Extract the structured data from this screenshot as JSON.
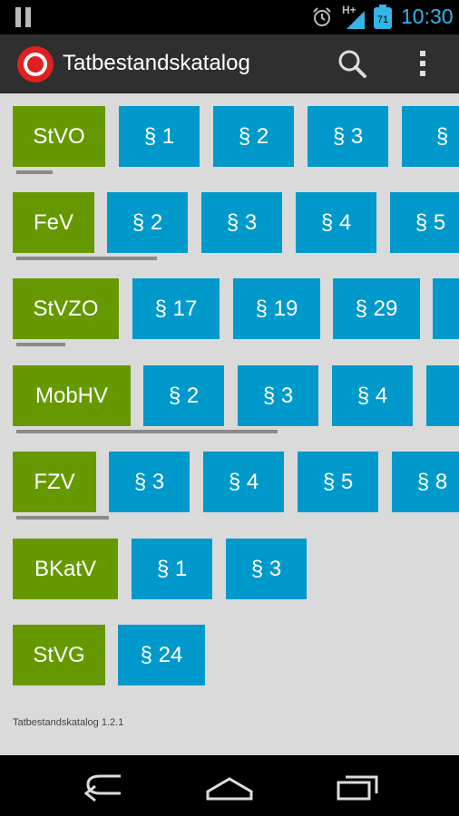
{
  "status": {
    "time": "10:30",
    "network": "H+",
    "battery_level": "71",
    "icons": [
      "pause-icon",
      "alarm-icon",
      "signal-icon",
      "battery-icon"
    ]
  },
  "app": {
    "title": "Tatbestandskatalog",
    "icons": [
      "police-stop-logo-icon",
      "search-icon",
      "overflow-menu-icon"
    ]
  },
  "colors": {
    "category": "#669900",
    "section": "#0099cc",
    "content_bg": "#dadada",
    "actionbar": "#2f2f2f",
    "status_text": "#33b5e5"
  },
  "rows": [
    {
      "label": "StVO",
      "sections": [
        "§ 1",
        "§ 2",
        "§ 3",
        "§"
      ]
    },
    {
      "label": "FeV",
      "sections": [
        "§ 2",
        "§ 3",
        "§ 4",
        "§ 5"
      ]
    },
    {
      "label": "StVZO",
      "sections": [
        "§ 17",
        "§ 19",
        "§ 29",
        ""
      ]
    },
    {
      "label": "MobHV",
      "sections": [
        "§ 2",
        "§ 3",
        "§ 4",
        ""
      ]
    },
    {
      "label": "FZV",
      "sections": [
        "§ 3",
        "§ 4",
        "§ 5",
        "§ 8"
      ]
    },
    {
      "label": "BKatV",
      "sections": [
        "§ 1",
        "§ 3"
      ]
    },
    {
      "label": "StVG",
      "sections": [
        "§ 24"
      ]
    }
  ],
  "footer": {
    "version": "Tatbestandskatalog 1.2.1"
  },
  "navbar": {
    "icons": [
      "back-icon",
      "home-icon",
      "recent-apps-icon"
    ]
  }
}
